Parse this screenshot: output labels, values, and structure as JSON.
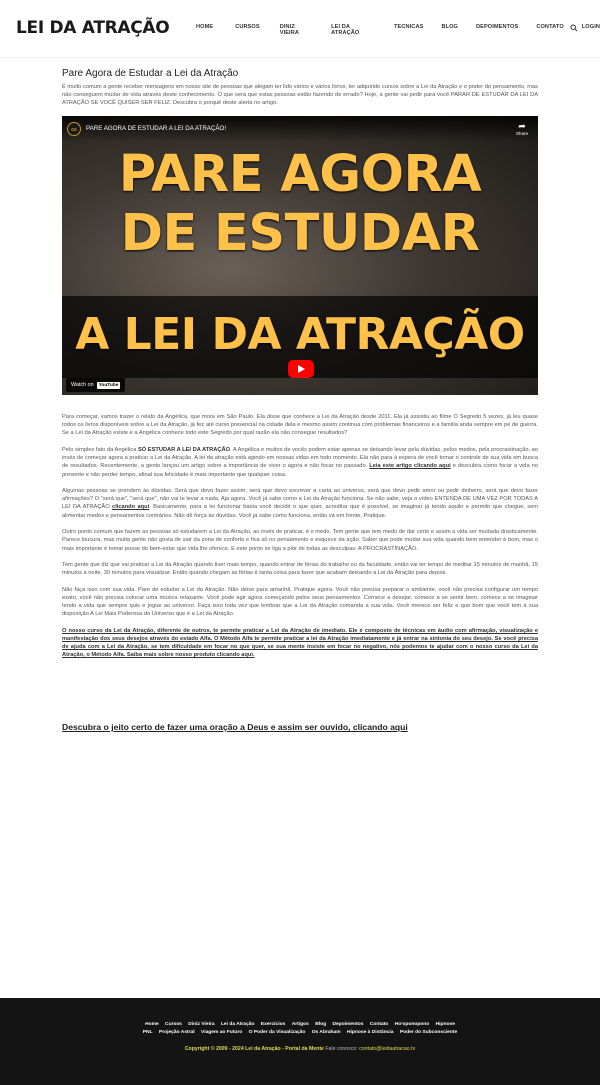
{
  "header": {
    "logo": "LEI DA ATRAÇÃO",
    "nav": [
      "Home",
      "CURSOS",
      "DINIZ VIEIRA",
      "LEI DA ATRAÇÃO",
      "TECNICAS",
      "BLOG",
      "DEPOIMENTOS",
      "CONTATO",
      "LOGIN"
    ],
    "search_icon": "search-icon"
  },
  "article": {
    "title": "Pare Agora de Estudar a Lei da Atração",
    "intro": "É muito comum a gente receber mensagens em nosso site de pessoas que alegam ter lido vários e vários livros, ter adquirido cursos sobre a Lei da Atração e o poder do pensamento, mas não conseguem mudar de vida através deste conhecimento. O que será que estas pessoas estão fazendo de errado? Hoje, a gente vai pedir para você PARAR DE ESTUDAR DA LEI DA ATRAÇÃO SE VOCÊ QUISER SER FELIZ. Descubra o porquê deste alerta no artigo."
  },
  "video": {
    "title": "PARE AGORA DE ESTUDAR A LEI DA ATRAÇÃO!",
    "share": "Share",
    "line1": "PARE AGORA",
    "line2": "DE ESTUDAR",
    "line3": "A LEI DA ATRAÇÃO",
    "watch_on": "Watch on",
    "youtube": "YouTube",
    "channel_icon": "infinity-icon"
  },
  "paragraphs": {
    "p1": "Para começar, vamos trazer o relato da Angélica, que mora em São Paulo. Ela disse que conhece a Lei da Atração desde 2011. Ela já assistiu ao filme O Segredo 5 vezes, já leu quase todos os livros disponíveis sobre a Lei da Atração, já fez até curso presencial na cidade dela e mesmo assim continua com problemas financeiros e a família anda sempre em pé de guerra. Se a Lei da Atração existe e a Angélica conhece todo este Segredo por qual razão ela não consegue resultados?",
    "p2_a": "Pelo simples fato da Angélica ",
    "p2_b": "SÓ ESTUDAR A LEI DA ATRAÇÃO",
    "p2_c": ". A Angélica e muitos de vocês podem estar apenas se deixando levar pela dúvidas, pelos medos, pela procrastinação, ao invés de começar agora a praticar a Lei da Atração. A lei da atração está agindo em nossas vidas em todo momento. Ela não para à espera de você tomar o controle de sua vida em busca de resultados. Recentemente, a gente lançou um artigo sobre a importância de viver o agora e não focar no passado. ",
    "p2_link": "Leia este artigo clicando aqui",
    "p2_d": " e descubra como focar a vida no presente e não perder tempo, afinal sua felicidade é mais importante que qualquer coisa.",
    "p3_a": "Algumas pessoas se prendem às dúvidas. Será que devo fazer assim, será que devo escrever a carta ao universo, será que devo pedir amor ou pedir dinheiro, será que devo fazer afirmações? O \"será que\", \"será que\", não vai te levar a nada. Aja agora. Você já sabe como a Lei da Atração funciona. Se não sabe, veja o vídeo ENTENDA DE UMA VEZ POR TODAS A LEI DA ATRAÇÃO ",
    "p3_link": "clicando aqui",
    "p3_b": ". Basicamente, para a lei funcionar basta você decidir o que quer, acreditar que é possível, se imaginar já tendo aquilo e permitir que chegue, sem alimentar medos e pensamentos contrários. Não dê força às dúvidas. Você já sabe como funciona, então vá em frente. Pratique.",
    "p4": "Outro ponto comum que fazem as pessoas só estudarem a Lei da Atração, ao invés de praticar, é o medo. Tem gente que tem medo de dar certo e assim a vida ser mudada drasticamente. Parece loucura, mas muita gente não gosta de sair da zona de conforto e fica só no pensamento e esquece da ação. Saber que pode mudar sua vida quando bem entender é bom, mas o mais importante é tomar posse do bem-estar que vida lhe oferece. E este ponto se liga a pior de todas as desculpas: A PROCRASTINAÇÃO.",
    "p5": "Tem gente que diz que vai praticar a Lei da Atração quando tiver mais tempo, quando entrar de férias do trabalho ou da faculdade, então vai ter tempo de meditar 15 minutos de manhã, 15 minutos à noite, 30 minutos para visualizar. Então quando chegam as férias é tanta coisa para fazer que acabam deixando a Lei da Atração para depois.",
    "p6": "Não faça isso com sua vida. Pare de estudar a Lei da Atração. Não deixe para amanhã. Pratique agora. Você não precisa preparar o ambiente, você não precisa configurar um tempo exato, você não precisa colocar uma música relaxante. Você pode agir agora começando pelos seus pensamentos. Comece a desejar, comece a se sentir bem, comece a se imaginar tendo a vida que sempre quis e jogue ao universo. Faça isso toda vez que lembrar que a Lei da Atração comanda a sua vida. Você merece ser feliz e que bom que você tem à sua disposição A Lei Mais Poderosa do Universo que é a Lei da Atração.",
    "p7_link": "O nosso curso da Lei da Atração, diferente de outros, te permite praticar a Lei da Atração de imediato. Ele é composto de técnicas em áudio com afirmação, visualização e manifestação dos seus desejos através do estado Alfa. O Método Alfa te permite praticar a lei da Atração imediatamente e já entrar na sintonia do seu desejo. Se você precisa de ajuda com a Lei da Atração, se tem dificuldade em focar no que quer, se sua mente insiste em focar no negativo, nós podemos te ajudar com o nosso curso da Lei da Atração, o Método Alfa. Saiba mais sobre nosso produto clicando aqui.",
    "h2": "Descubra o jeito certo de fazer uma oração a Deus e assim ser ouvido, clicando aqui"
  },
  "footer": {
    "row1": [
      "Home",
      "Cursos",
      "Diniz Vieira",
      "Lei da Atração",
      "Exercícios",
      "Artigos",
      "Blog",
      "Depoimentos",
      "Contato",
      "Ho'oponopono",
      "Hipnose"
    ],
    "row2": [
      "PNL",
      "Projeção Astral",
      "Viagem ao Futuro",
      "O Poder da Visualização",
      "Os Abraham",
      "Hipnose à Distância",
      "Poder do Subconsciente"
    ],
    "copyright": "Copyright © 2009 - 2024 Lei da Atração - Portal da Mente",
    "contact_label": "Fale conosco:",
    "contact_email": "contato@leidaatracao.tv"
  }
}
